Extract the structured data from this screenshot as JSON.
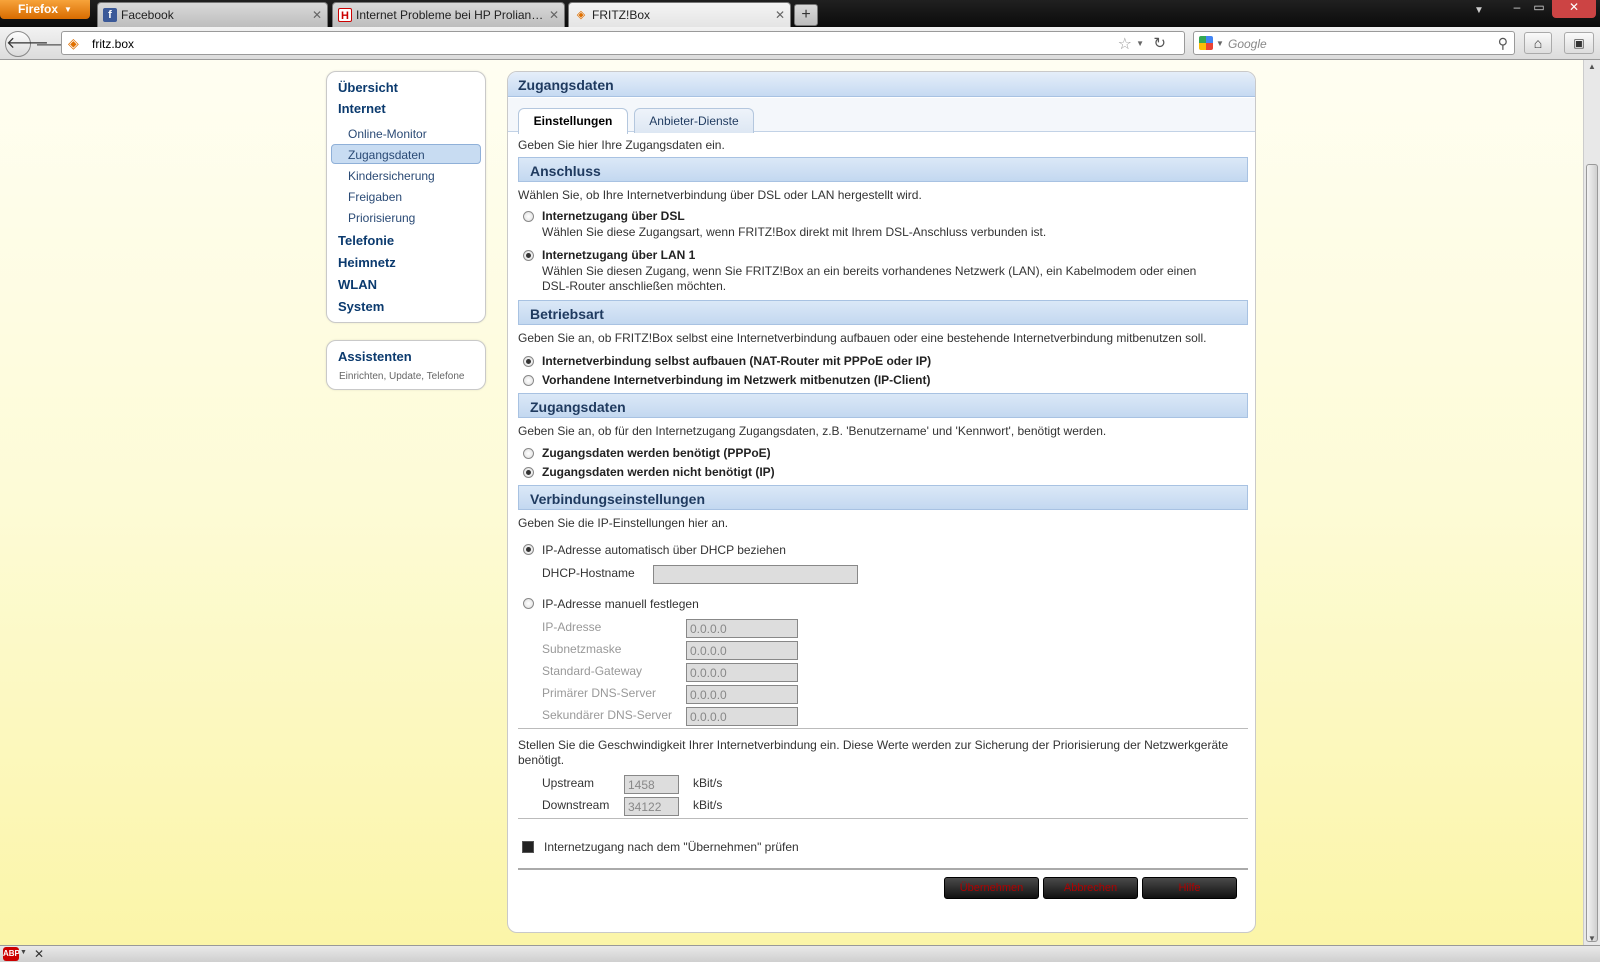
{
  "browser": {
    "menu_button": "Firefox",
    "tabs": [
      {
        "label": "Facebook"
      },
      {
        "label": "Internet Probleme bei HP Proliant DL ..."
      },
      {
        "label": "FRITZ!Box"
      }
    ],
    "url": "fritz.box",
    "search_placeholder": "Google"
  },
  "sidebar": {
    "main": [
      "Übersicht",
      "Internet",
      "Telefonie",
      "Heimnetz",
      "WLAN",
      "System"
    ],
    "sub": [
      "Online-Monitor",
      "Zugangsdaten",
      "Kindersicherung",
      "Freigaben",
      "Priorisierung"
    ],
    "assist_title": "Assistenten",
    "assist_sub": "Einrichten, Update, Telefone"
  },
  "panel": {
    "title": "Zugangsdaten",
    "tabs": [
      "Einstellungen",
      "Anbieter-Dienste"
    ],
    "intro": "Geben Sie hier Ihre Zugangsdaten ein.",
    "anschluss": {
      "title": "Anschluss",
      "desc": "Wählen Sie, ob Ihre Internetverbindung über DSL oder LAN hergestellt wird.",
      "opt1_title": "Internetzugang über DSL",
      "opt1_desc": "Wählen Sie diese Zugangsart, wenn FRITZ!Box direkt mit Ihrem DSL-Anschluss verbunden ist.",
      "opt2_title": "Internetzugang über LAN 1",
      "opt2_desc1": "Wählen Sie diesen Zugang, wenn Sie FRITZ!Box an ein bereits vorhandenes Netzwerk (LAN), ein Kabelmodem oder einen",
      "opt2_desc2": "DSL-Router anschließen möchten."
    },
    "betriebsart": {
      "title": "Betriebsart",
      "desc": "Geben Sie an, ob FRITZ!Box selbst eine Internetverbindung aufbauen oder eine bestehende Internetverbindung mitbenutzen soll.",
      "opt1": "Internetverbindung selbst aufbauen (NAT-Router mit PPPoE oder IP)",
      "opt2": "Vorhandene Internetverbindung im Netzwerk mitbenutzen (IP-Client)"
    },
    "zugangsdaten": {
      "title": "Zugangsdaten",
      "desc": "Geben Sie an, ob für den Internetzugang Zugangsdaten, z.B. 'Benutzername' und 'Kennwort', benötigt werden.",
      "opt1": "Zugangsdaten werden benötigt (PPPoE)",
      "opt2": "Zugangsdaten werden nicht benötigt (IP)"
    },
    "verbindung": {
      "title": "Verbindungseinstellungen",
      "desc": "Geben Sie die IP-Einstellungen hier an.",
      "dhcp_opt": "IP-Adresse automatisch über DHCP beziehen",
      "dhcp_host_label": "DHCP-Hostname",
      "manual_opt": "IP-Adresse manuell festlegen",
      "fields": [
        {
          "label": "IP-Adresse",
          "value": "0.0.0.0"
        },
        {
          "label": "Subnetzmaske",
          "value": "0.0.0.0"
        },
        {
          "label": "Standard-Gateway",
          "value": "0.0.0.0"
        },
        {
          "label": "Primärer DNS-Server",
          "value": "0.0.0.0"
        },
        {
          "label": "Sekundärer DNS-Server",
          "value": "0.0.0.0"
        }
      ],
      "speed_desc1": "Stellen Sie die Geschwindigkeit Ihrer Internetverbindung ein. Diese Werte werden zur Sicherung der Priorisierung der Netzwerkgeräte",
      "speed_desc2": "benötigt.",
      "upstream_label": "Upstream",
      "upstream_value": "1458",
      "downstream_label": "Downstream",
      "downstream_value": "34122",
      "unit": "kBit/s"
    },
    "check_label": "Internetzugang nach dem \"Übernehmen\" prüfen",
    "buttons": [
      "Übernehmen",
      "Abbrechen",
      "Hilfe"
    ]
  },
  "colors": {
    "accent_blue": "#1f3a5f",
    "page_yellow": "#fbf5a8",
    "button_text": "#b00000"
  }
}
